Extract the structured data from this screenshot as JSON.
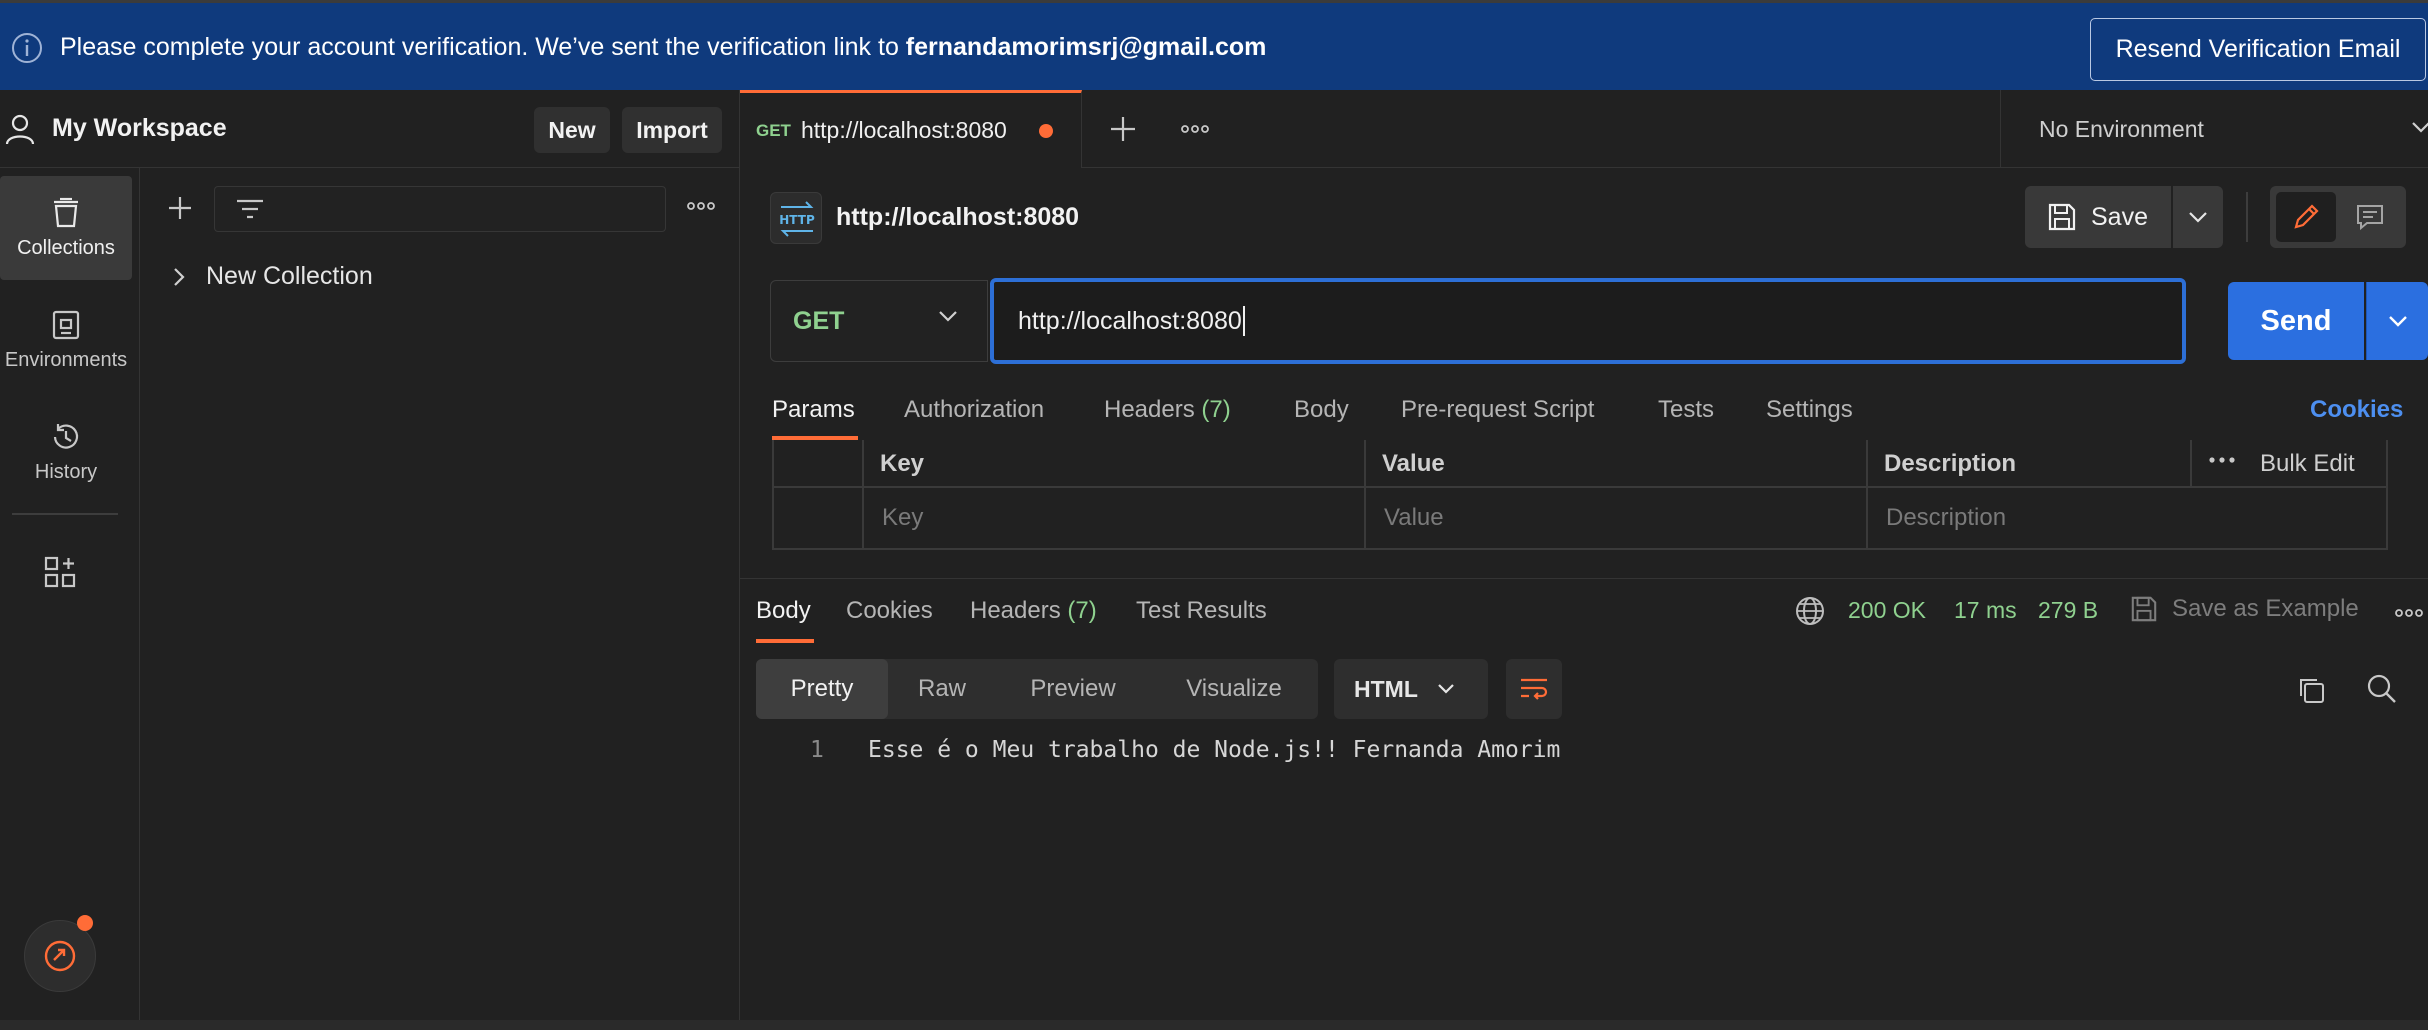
{
  "banner": {
    "message": "Please complete your account verification. We’ve sent the verification link to ",
    "email": "fernandamorimsrj@gmail.com",
    "resend_label": "Resend Verification Email"
  },
  "workspace": {
    "title": "My Workspace",
    "new_label": "New",
    "import_label": "Import"
  },
  "rail": {
    "items": [
      {
        "label": "Collections",
        "icon": "trash-bin-collections-icon",
        "active": true
      },
      {
        "label": "Environments",
        "icon": "environment-icon",
        "active": false
      },
      {
        "label": "History",
        "icon": "history-icon",
        "active": false
      }
    ]
  },
  "sidebar": {
    "collection": "New Collection"
  },
  "tabs": {
    "active": {
      "method": "GET",
      "url": "http://localhost:8080"
    },
    "environment": "No Environment"
  },
  "request": {
    "name": "http://localhost:8080",
    "save_label": "Save",
    "method": "GET",
    "url": "http://localhost:8080",
    "send_label": "Send",
    "tabs": [
      {
        "label": "Params"
      },
      {
        "label": "Authorization"
      },
      {
        "label": "Headers",
        "count": "(7)"
      },
      {
        "label": "Body"
      },
      {
        "label": "Pre-request Script"
      },
      {
        "label": "Tests"
      },
      {
        "label": "Settings"
      }
    ],
    "cookies_label": "Cookies",
    "params": {
      "headers": [
        "Key",
        "Value",
        "Description"
      ],
      "bulk_edit": "Bulk Edit",
      "placeholders": [
        "Key",
        "Value",
        "Description"
      ]
    }
  },
  "response": {
    "tabs": [
      {
        "label": "Body"
      },
      {
        "label": "Cookies"
      },
      {
        "label": "Headers",
        "count": "(7)"
      },
      {
        "label": "Test Results"
      }
    ],
    "status": "200 OK",
    "time": "17 ms",
    "size": "279 B",
    "save_example_label": "Save as Example",
    "formats": [
      "Pretty",
      "Raw",
      "Preview",
      "Visualize"
    ],
    "language": "HTML",
    "line_number": "1",
    "body": "Esse é o Meu trabalho de Node.js!! Fernanda Amorim"
  },
  "colors": {
    "accent": "#ff6c37",
    "send": "#2b6fe0",
    "banner": "#0f3a7d",
    "success": "#8fd18f"
  }
}
